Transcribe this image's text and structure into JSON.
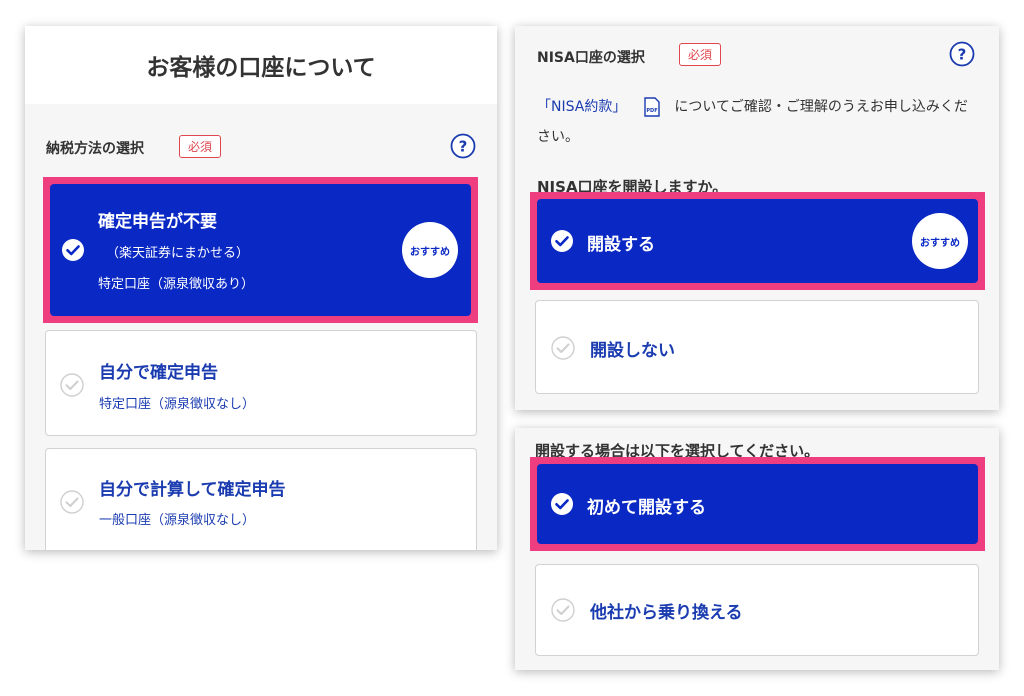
{
  "left": {
    "header_title": "お客様の口座について",
    "section_title": "納税方法の選択",
    "required_label": "必須",
    "options": [
      {
        "title": "確定申告が不要",
        "subtitle_1": "（楽天証券にまかせる）",
        "subtitle_2": "特定口座（源泉徴収あり）",
        "badge": "おすすめ",
        "selected": true
      },
      {
        "title": "自分で確定申告",
        "subtitle": "特定口座（源泉徴収なし）",
        "selected": false
      },
      {
        "title": "自分で計算して確定申告",
        "subtitle": "一般口座（源泉徴収なし）",
        "selected": false
      }
    ]
  },
  "nisa": {
    "section_title": "NISA口座の選択",
    "required_label": "必須",
    "terms_link": "「NISA約款」",
    "description_rest": "についてご確認・ご理解のうえお申し込みください。",
    "question": "NISA口座を開設しますか。",
    "options": [
      {
        "title": "開設する",
        "badge": "おすすめ",
        "selected": true
      },
      {
        "title": "開設しない",
        "selected": false
      }
    ]
  },
  "open_type": {
    "question": "開設する場合は以下を選択してください。",
    "options": [
      {
        "title": "初めて開設する",
        "selected": true
      },
      {
        "title": "他社から乗り換える",
        "selected": false
      }
    ]
  },
  "colors": {
    "selected_fill": "#0a28c4",
    "selected_frame": "#ee3e80",
    "unselected_text": "#1b3cb0",
    "required_red": "#e0474f"
  },
  "icons": {
    "help": "question-circle-icon",
    "check_selected": "check-circle-filled-icon",
    "check_unselected": "check-circle-outline-icon",
    "pdf": "pdf-file-icon"
  }
}
